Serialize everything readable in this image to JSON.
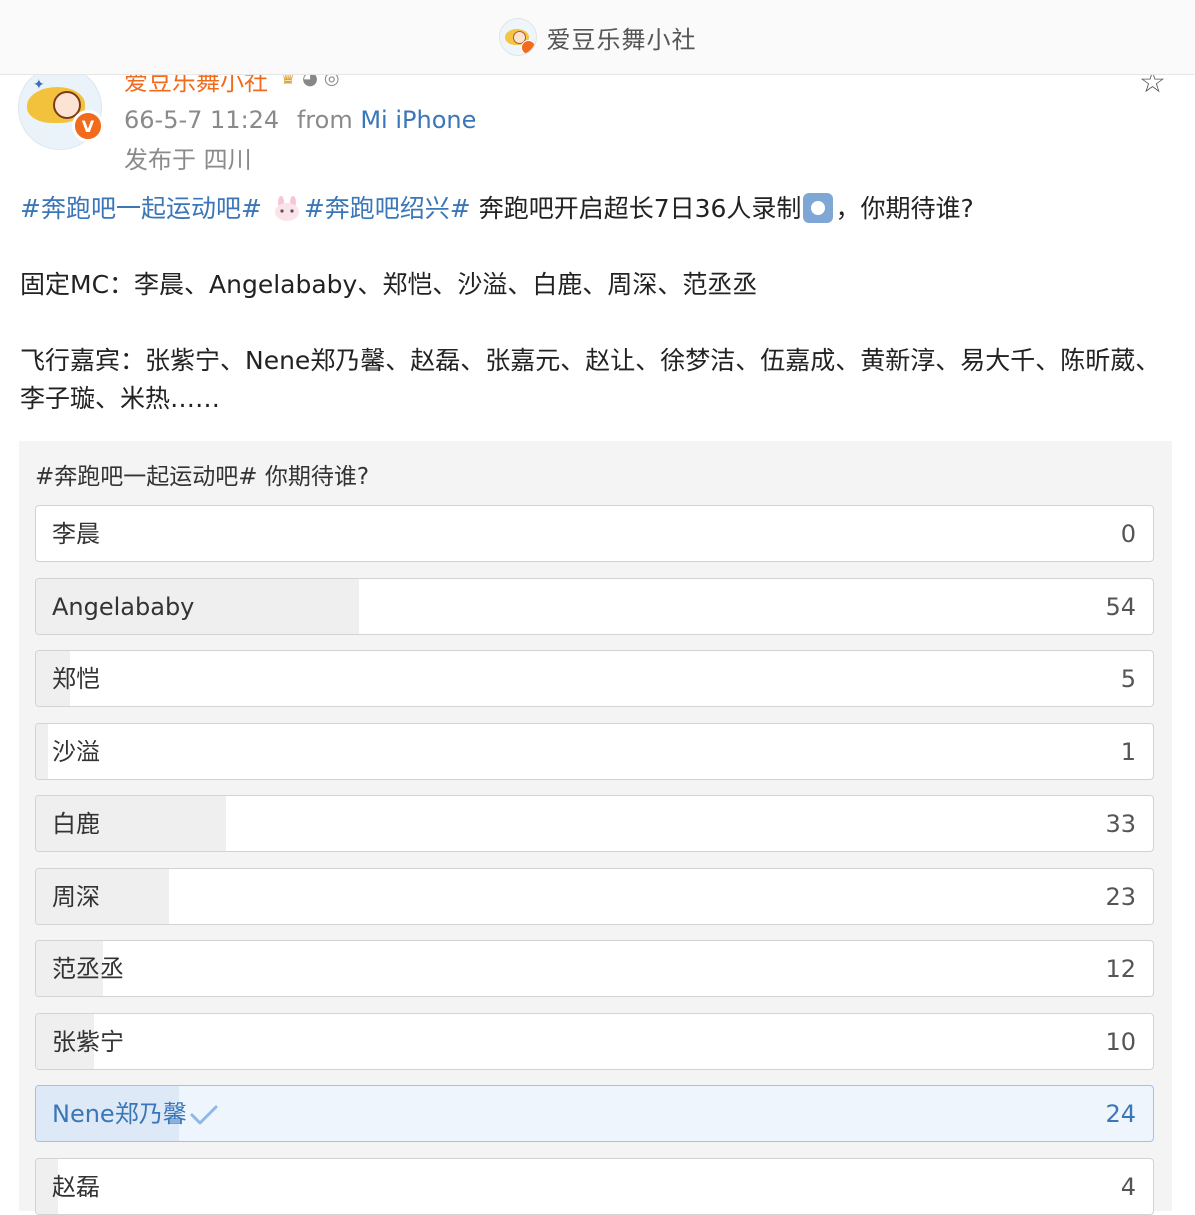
{
  "topbar": {
    "title": "爱豆乐舞小社"
  },
  "post": {
    "user_name": "爱豆乐舞小社",
    "verified_mark": "V",
    "timestamp": "66-5-7 11:24",
    "from_label": "from",
    "source": "Mi iPhone",
    "location": "发布于 四川",
    "line1": {
      "hashtag1": "#奔跑吧一起运动吧#",
      "hashtag2": "#奔跑吧绍兴#",
      "text_a": " 奔跑吧开启超长7日36人录制",
      "text_b": "，你期待谁?"
    },
    "line2": "固定MC：李晨、Angelababy、郑恺、沙溢、白鹿、周深、范丞丞",
    "line3": "飞行嘉宾：张紫宁、Nene郑乃馨、赵磊、张嘉元、赵让、徐梦洁、伍嘉成、黄新淳、易大千、陈昕葳、李子璇、米热……"
  },
  "poll": {
    "title": "#奔跑吧一起运动吧# 你期待谁?",
    "options": [
      {
        "label": "李晨",
        "count": "0",
        "fraction": 0.0,
        "selected": false
      },
      {
        "label": "Angelababy",
        "count": "54",
        "fraction": 0.289,
        "selected": false
      },
      {
        "label": "郑恺",
        "count": "5",
        "fraction": 0.03,
        "selected": false
      },
      {
        "label": "沙溢",
        "count": "1",
        "fraction": 0.011,
        "selected": false
      },
      {
        "label": "白鹿",
        "count": "33",
        "fraction": 0.17,
        "selected": false
      },
      {
        "label": "周深",
        "count": "23",
        "fraction": 0.119,
        "selected": false
      },
      {
        "label": "范丞丞",
        "count": "12",
        "fraction": 0.06,
        "selected": false
      },
      {
        "label": "张紫宁",
        "count": "10",
        "fraction": 0.052,
        "selected": false
      },
      {
        "label": "Nene郑乃馨",
        "count": "24",
        "fraction": 0.128,
        "selected": true
      },
      {
        "label": "赵磊",
        "count": "4",
        "fraction": 0.02,
        "selected": false
      }
    ]
  },
  "colors": {
    "accent_blue": "#3a76b8",
    "username_orange": "#f26b1d"
  },
  "icons": [
    "star-outline-icon",
    "checkmark-icon",
    "verified-v-icon"
  ]
}
